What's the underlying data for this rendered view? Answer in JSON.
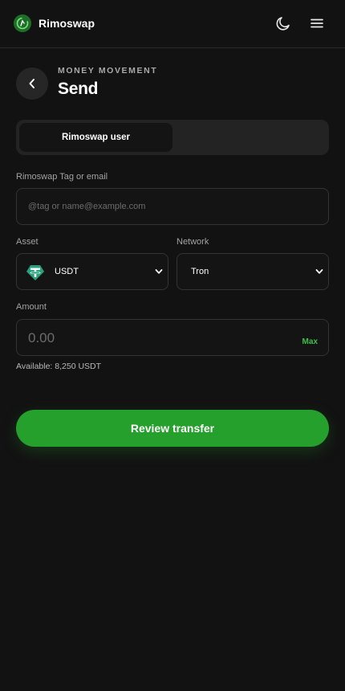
{
  "header": {
    "brand_name": "Rimoswap",
    "theme_icon": "moon-icon",
    "menu_icon": "hamburger-menu-icon"
  },
  "title_area": {
    "eyebrow": "MONEY MOVEMENT",
    "title": "Send",
    "back_icon": "chevron-left-icon"
  },
  "tabs": {
    "active_label": "Rimoswap user",
    "inactive_label": ""
  },
  "recipient": {
    "label": "Rimoswap Tag or email",
    "placeholder": "@tag or name@example.com",
    "value": ""
  },
  "asset": {
    "label": "Asset",
    "selected": "USDT",
    "icon": "tether-icon"
  },
  "network": {
    "label": "Network",
    "selected": "Tron"
  },
  "amount": {
    "label": "Amount",
    "placeholder": "0.00",
    "value": "",
    "max_label": "Max",
    "available_text": "Available: 8,250 USDT"
  },
  "review_button_label": "Review transfer",
  "colors": {
    "background": "#121212",
    "accent_green": "#25a02c",
    "max_green": "#3fbf4a",
    "tether_teal": "#26a17b"
  }
}
